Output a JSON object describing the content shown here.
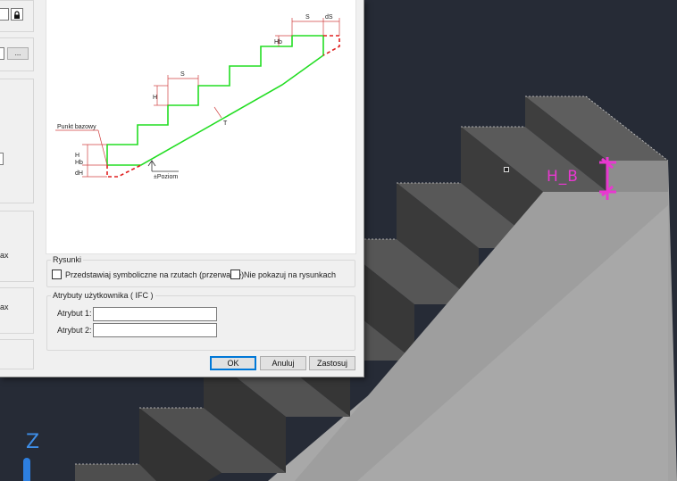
{
  "viewport": {
    "background": "#262b36",
    "axis_label": "Z",
    "dimension_label": "H_B",
    "dimension_color": "#e838d0"
  },
  "dialog": {
    "left_panel": {
      "browse_button": "...",
      "label_max_1": "ax",
      "label_max_2": "ax",
      "lock_icon": "lock-icon"
    },
    "preview": {
      "label_S_top": "S",
      "label_dS": "dS",
      "label_Hb_top": "Hb",
      "label_S_mid": "S",
      "label_H": "H",
      "label_T": "T",
      "label_punkt": "Punkt bazowy",
      "label_H_left": "H",
      "label_Hb_left": "Hb",
      "label_dH": "dH",
      "label_poziom": "±Poziom"
    },
    "rysunki": {
      "title": "Rysunki",
      "option1": "Przedstawiaj symboliczne na rzutach (przerwanie)",
      "option2": "Nie pokazuj na rysunkach"
    },
    "atrybuty": {
      "title": "Atrybuty użytkownika ( IFC )",
      "attr1_label": "Atrybut 1:",
      "attr1_value": "",
      "attr2_label": "Atrybut 2:",
      "attr2_value": ""
    },
    "buttons": {
      "ok": "OK",
      "cancel": "Anuluj",
      "apply": "Zastosuj"
    }
  }
}
